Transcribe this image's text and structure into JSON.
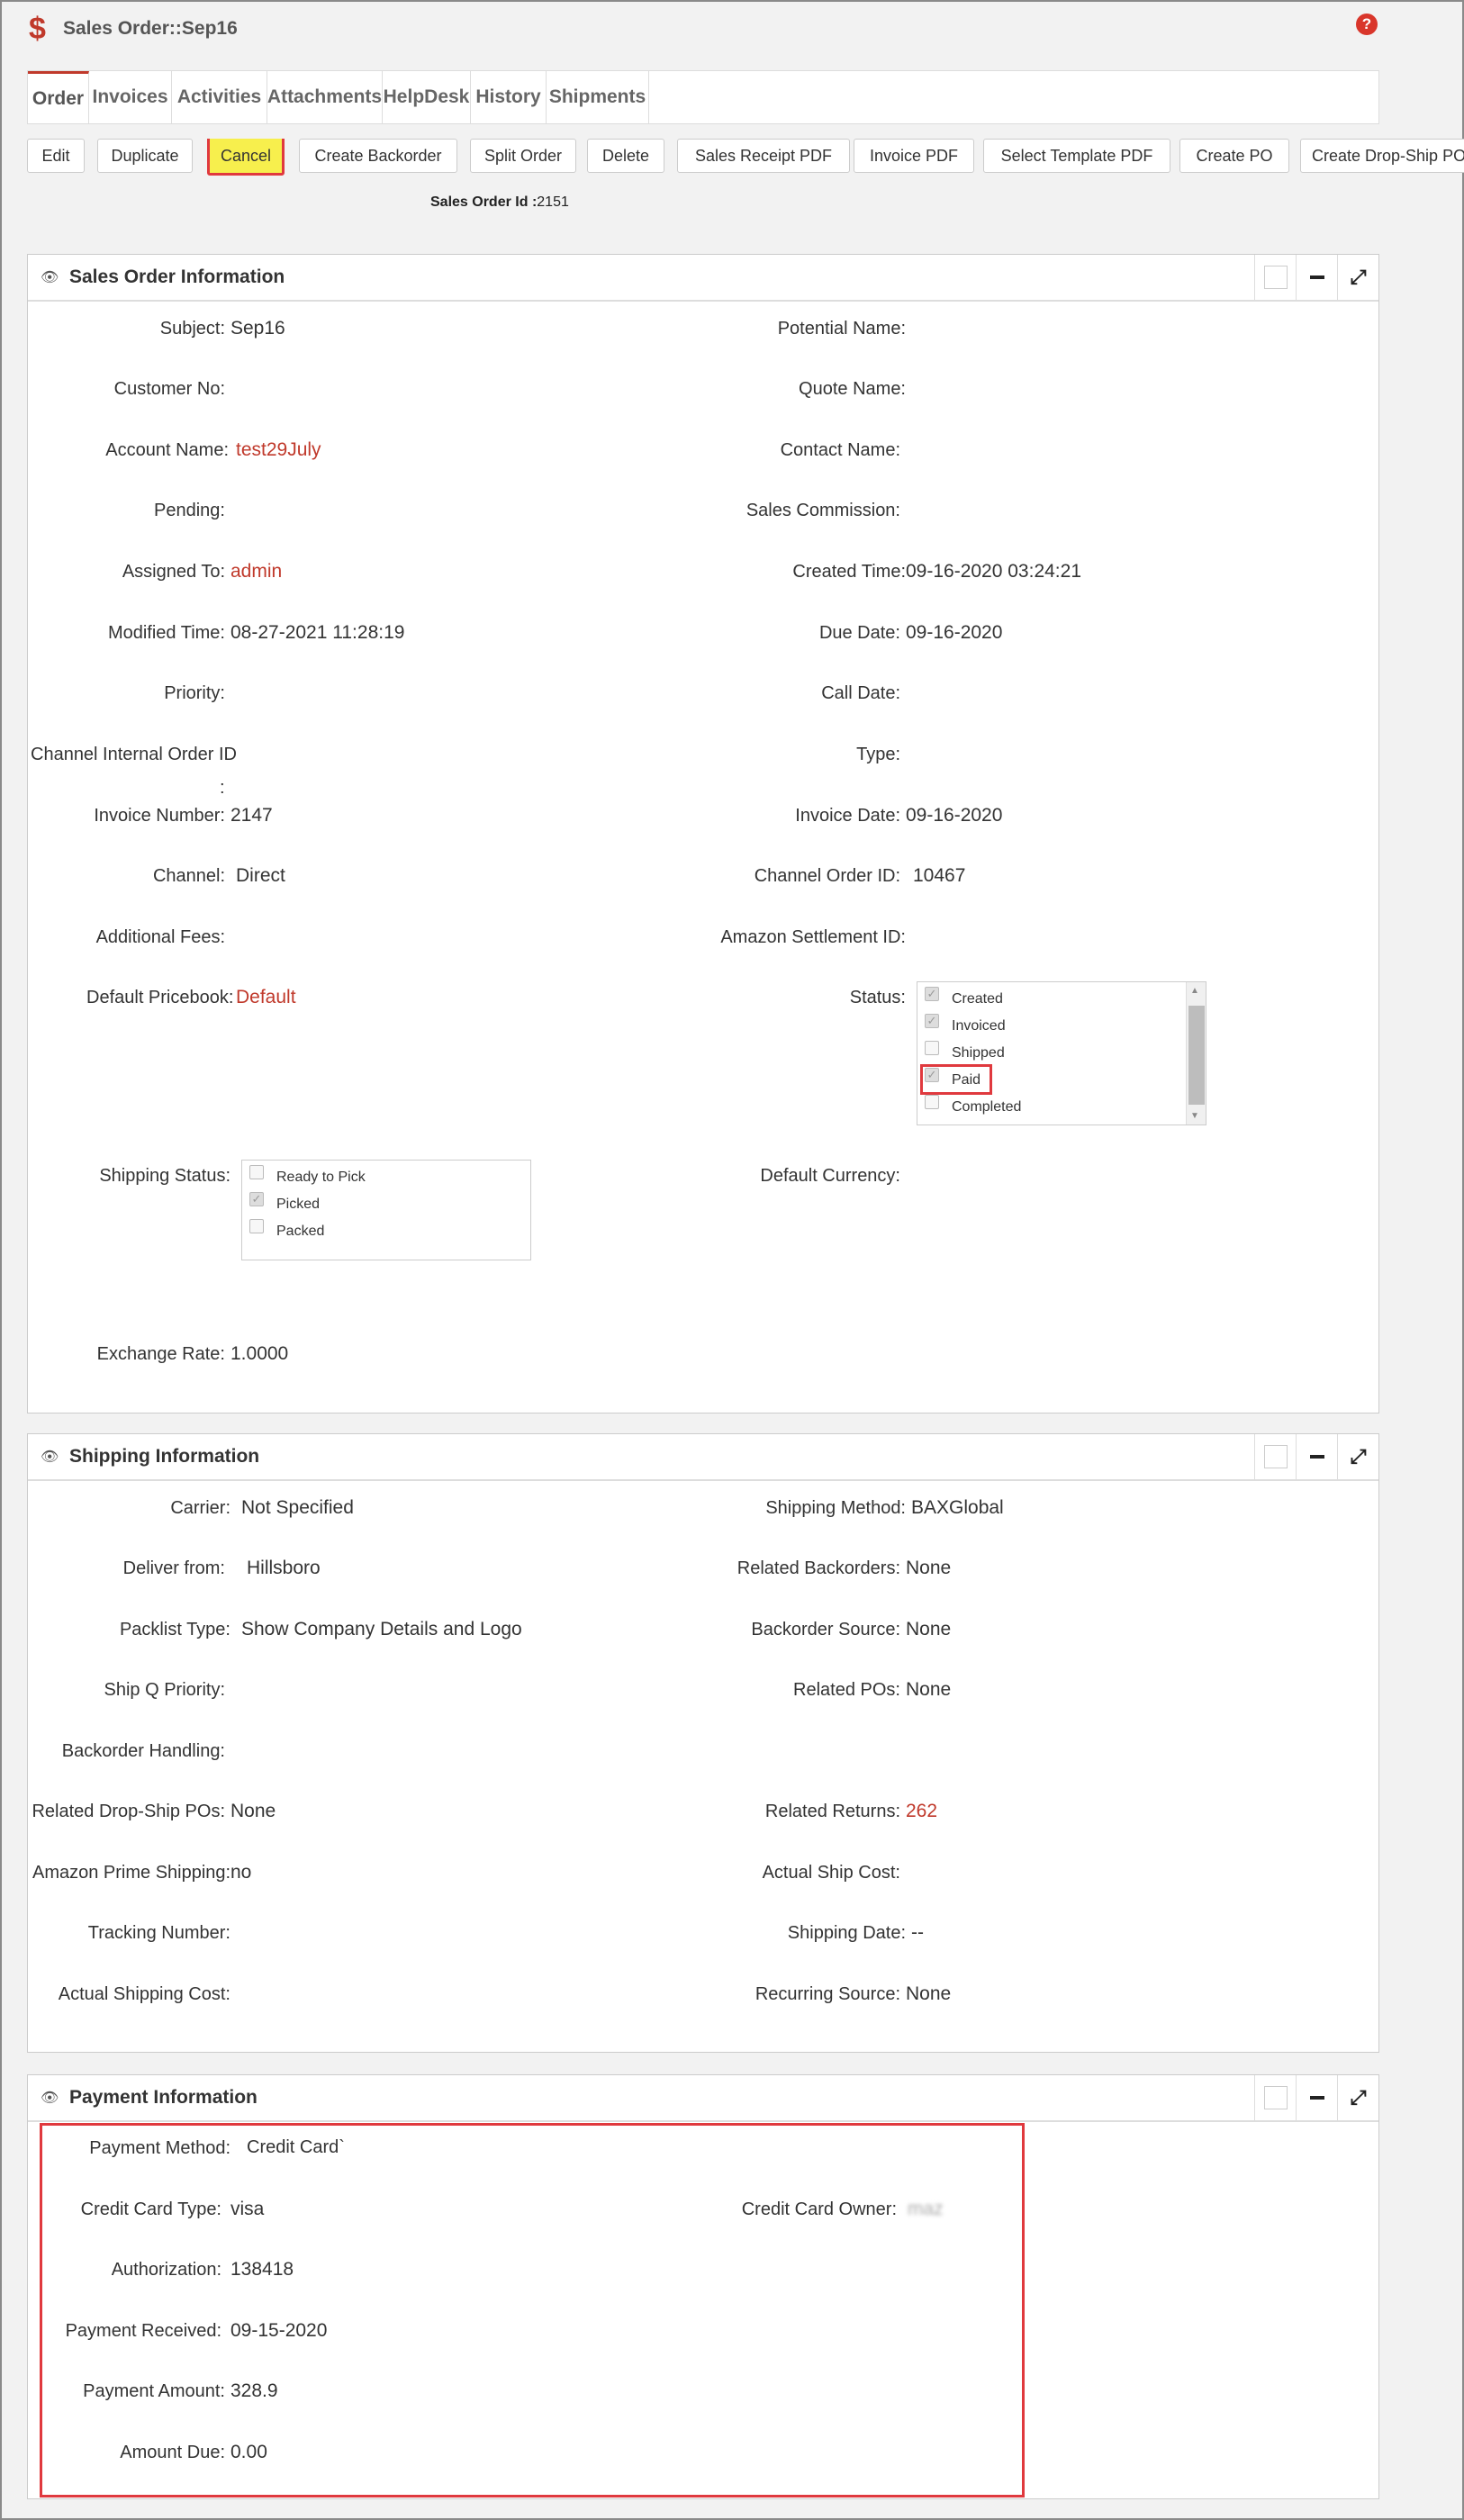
{
  "header": {
    "title": "Sales Order::Sep16",
    "icon": "dollar-icon",
    "help_icon": "help-icon"
  },
  "tabs": [
    "Order",
    "Invoices",
    "Activities",
    "Attachments",
    "HelpDesk",
    "History",
    "Shipments"
  ],
  "toolbar": {
    "edit": "Edit",
    "duplicate": "Duplicate",
    "cancel": "Cancel",
    "create_backorder": "Create Backorder",
    "split_order": "Split Order",
    "delete": "Delete",
    "sales_receipt_pdf": "Sales Receipt PDF",
    "invoice_pdf": "Invoice PDF",
    "select_template_pdf": "Select Template PDF",
    "create_po": "Create PO",
    "create_dropship_po": "Create Drop-Ship PO"
  },
  "order_id": {
    "label": "Sales Order Id :",
    "value": "2151"
  },
  "sales_order_info": {
    "title": "Sales Order Information",
    "subject": {
      "label": "Subject:",
      "value": "Sep16"
    },
    "potential_name": {
      "label": "Potential Name:",
      "value": ""
    },
    "customer_no": {
      "label": "Customer No:",
      "value": ""
    },
    "quote_name": {
      "label": "Quote Name:",
      "value": ""
    },
    "account_name": {
      "label": "Account Name:",
      "value": "test29July"
    },
    "contact_name": {
      "label": "Contact Name:",
      "value": ""
    },
    "pending": {
      "label": "Pending:",
      "value": ""
    },
    "sales_commission": {
      "label": "Sales Commission:",
      "value": ""
    },
    "assigned_to": {
      "label": "Assigned To:",
      "value": "admin"
    },
    "created_time": {
      "label": "Created Time:",
      "value": "09-16-2020 03:24:21"
    },
    "modified_time": {
      "label": "Modified Time:",
      "value": "08-27-2021 11:28:19"
    },
    "due_date": {
      "label": "Due Date:",
      "value": "09-16-2020"
    },
    "priority": {
      "label": "Priority:",
      "value": ""
    },
    "call_date": {
      "label": "Call Date:",
      "value": ""
    },
    "channel_internal_order_id": {
      "label": "Channel Internal Order ID",
      "label2": ":",
      "value": ""
    },
    "type": {
      "label": "Type:",
      "value": ""
    },
    "invoice_number": {
      "label": "Invoice Number:",
      "value": "2147"
    },
    "invoice_date": {
      "label": "Invoice Date:",
      "value": "09-16-2020"
    },
    "channel": {
      "label": "Channel:",
      "value": "Direct"
    },
    "channel_order_id": {
      "label": "Channel Order ID:",
      "value": "10467"
    },
    "additional_fees": {
      "label": "Additional Fees:",
      "value": ""
    },
    "amazon_settlement_id": {
      "label": "Amazon Settlement ID:",
      "value": ""
    },
    "default_pricebook": {
      "label": "Default Pricebook:",
      "value": "Default"
    },
    "status": {
      "label": "Status:",
      "options": [
        {
          "label": "Created",
          "checked": true
        },
        {
          "label": "Invoiced",
          "checked": true
        },
        {
          "label": "Shipped",
          "checked": false
        },
        {
          "label": "Paid",
          "checked": true
        },
        {
          "label": "Completed",
          "checked": false
        }
      ]
    },
    "shipping_status": {
      "label": "Shipping Status:",
      "options": [
        {
          "label": "Ready to Pick",
          "checked": false
        },
        {
          "label": "Picked",
          "checked": true
        },
        {
          "label": "Packed",
          "checked": false
        }
      ]
    },
    "default_currency": {
      "label": "Default Currency:",
      "value": ""
    },
    "exchange_rate": {
      "label": "Exchange Rate:",
      "value": "1.0000"
    }
  },
  "shipping_info": {
    "title": "Shipping Information",
    "carrier": {
      "label": "Carrier:",
      "value": "Not Specified"
    },
    "shipping_method": {
      "label": "Shipping Method:",
      "value": "BAXGlobal"
    },
    "deliver_from": {
      "label": "Deliver from:",
      "value": "Hillsboro"
    },
    "related_backorders": {
      "label": "Related Backorders:",
      "value": "None"
    },
    "packlist_type": {
      "label": "Packlist Type:",
      "value": "Show Company Details and Logo"
    },
    "backorder_source": {
      "label": "Backorder Source:",
      "value": "None"
    },
    "ship_q_priority": {
      "label": "Ship Q Priority:",
      "value": ""
    },
    "related_pos": {
      "label": "Related POs:",
      "value": "None"
    },
    "backorder_handling": {
      "label": "Backorder Handling:",
      "value": ""
    },
    "related_dropship_pos": {
      "label": "Related Drop-Ship POs:",
      "value": "None"
    },
    "related_returns": {
      "label": "Related Returns:",
      "value": "262"
    },
    "amazon_prime_shipping": {
      "label": "Amazon Prime Shipping:",
      "value": "no"
    },
    "actual_ship_cost": {
      "label": "Actual Ship Cost:",
      "value": ""
    },
    "tracking_number": {
      "label": "Tracking Number:",
      "value": ""
    },
    "shipping_date": {
      "label": "Shipping Date:",
      "value": "--"
    },
    "actual_shipping_cost": {
      "label": "Actual Shipping Cost:",
      "value": ""
    },
    "recurring_source": {
      "label": "Recurring Source:",
      "value": "None"
    }
  },
  "payment_info": {
    "title": "Payment Information",
    "payment_method": {
      "label": "Payment Method:",
      "value": "Credit Card`"
    },
    "credit_card_type": {
      "label": "Credit Card Type:",
      "value": "visa"
    },
    "credit_card_owner": {
      "label": "Credit Card Owner:",
      "value": "maz"
    },
    "authorization": {
      "label": "Authorization:",
      "value": "138418"
    },
    "payment_received": {
      "label": "Payment Received:",
      "value": "09-15-2020"
    },
    "payment_amount": {
      "label": "Payment Amount:",
      "value": "328.9"
    },
    "amount_due": {
      "label": "Amount Due:",
      "value": "0.00"
    }
  },
  "colors": {
    "accent": "#c0392b",
    "highlight_border": "#e0393e",
    "highlight_fill": "#f7ef4d"
  }
}
